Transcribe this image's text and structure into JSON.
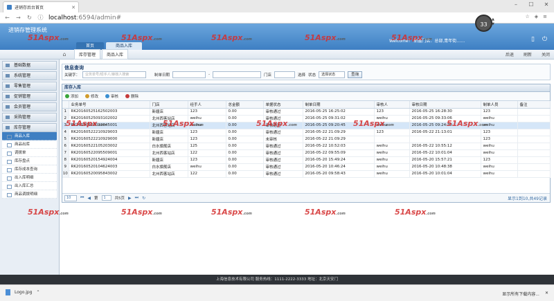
{
  "browser": {
    "tab_title": "进销存后台首页",
    "url_host": "localhost",
    "url_path": ":6594/admin#",
    "speed": "33"
  },
  "header": {
    "app_title": "进销存管理系统",
    "tabs": [
      {
        "label": "首页",
        "active": false
      },
      {
        "label": "商品入库",
        "active": true
      }
    ],
    "user_text": "Welcome！ 新疆门店：总部,青年街……"
  },
  "crumbs": {
    "items": [
      "库存管理",
      "商品入库"
    ],
    "actions": [
      "后退",
      "刷新",
      "关闭"
    ]
  },
  "sidebar": {
    "groups": [
      "基础数据",
      "系统管理",
      "零售管理",
      "促销管理",
      "会员管理",
      "采购管理",
      "库存管理"
    ],
    "items": [
      "商品入库",
      "商品出库",
      "调拨单",
      "库存盘点",
      "库存成本查询",
      "出入库明细",
      "出入库汇总",
      "商品调拨明细"
    ],
    "active_item": 0
  },
  "search": {
    "title": "信息查询",
    "keyword_label": "关键字：",
    "keyword_placeholder": "业务单号/经手人/审核人搜索",
    "date_label": "制单日期",
    "date_sep": "-",
    "store_label": "门店",
    "status_prefix": "选择",
    "status_label": "状态",
    "status_value": "选择状态",
    "query_button": "查询"
  },
  "grid": {
    "title": "库存入库",
    "toolbar": [
      "添加",
      "修改",
      "审核",
      "删除"
    ],
    "columns": [
      "业务单号",
      "门店",
      "经手人",
      "总金额",
      "单据状态",
      "制单日期",
      "审核人",
      "审核日期",
      "制单人员",
      "备注"
    ],
    "rows": [
      [
        "1",
        "RK20160525162502003",
        "新疆店",
        "123",
        "0.00",
        "审核通过",
        "2016-05-25 16:25:02",
        "123",
        "2016-05-25 16:28:30",
        "123",
        ""
      ],
      [
        "2",
        "RK20160525093102002",
        "北州西客站店",
        "weihu",
        "0.00",
        "审核通过",
        "2016-05-25 09:31:02",
        "weihu",
        "2016-05-25 09:33:06",
        "weihu",
        ""
      ],
      [
        "3",
        "RK20160525092045001",
        "北州西客站店",
        "weihu",
        "0.00",
        "审核通过",
        "2016-05-25 09:20:45",
        "weihu",
        "2016-05-25 09:24:30",
        "weihu",
        ""
      ],
      [
        "4",
        "RK20160522210929003",
        "新疆店",
        "123",
        "0.00",
        "审核通过",
        "2016-05-22 21:09:29",
        "123",
        "2016-05-22 21:13:01",
        "123",
        ""
      ],
      [
        "5",
        "RK20160522210929000",
        "新疆店",
        "123",
        "0.00",
        "未审核",
        "2016-05-22 21:09:29",
        "",
        "",
        "123",
        ""
      ],
      [
        "6",
        "RK20160522105203002",
        "白水旗舰店",
        "125",
        "0.00",
        "审核通过",
        "2016-05-22 10:52:03",
        "weihu",
        "2016-05-22 10:55:12",
        "weihu",
        ""
      ],
      [
        "7",
        "RK20160522095509001",
        "北州西客站店",
        "122",
        "0.00",
        "审核通过",
        "2016-05-22 09:55:09",
        "weihu",
        "2016-05-22 10:01:04",
        "weihu",
        ""
      ],
      [
        "8",
        "RK20160520154924004",
        "新疆店",
        "123",
        "0.00",
        "审核通过",
        "2016-05-20 15:49:24",
        "weihu",
        "2016-05-20 15:57:21",
        "123",
        ""
      ],
      [
        "9",
        "RK20160520104624003",
        "白水旗舰店",
        "weihu",
        "0.00",
        "审核通过",
        "2016-05-20 10:46:24",
        "weihu",
        "2016-05-20 10:48:38",
        "weihu",
        ""
      ],
      [
        "10",
        "RK20160520095843002",
        "北州西客站店",
        "122",
        "0.00",
        "审核通过",
        "2016-05-20 09:58:43",
        "weihu",
        "2016-05-20 10:01:04",
        "weihu",
        ""
      ]
    ],
    "selected_row": 2
  },
  "pager": {
    "page_size": "10",
    "page_prefix": "第",
    "page_value": "1",
    "page_suffix": "共5页",
    "info": "显示1到10,共49记录"
  },
  "footer": {
    "text": "上海信息技术有限公司  服务热线：1111-2222-3333 地址：北京天安门"
  },
  "downloads": {
    "file": "Logo.jpg",
    "show_all": "显示所有下载内容...",
    "close": "✕"
  },
  "watermark": {
    "brand": "51Aspx",
    "suffix": ".com"
  },
  "colors": {
    "header_blue": "#3e7fc3",
    "selected_row": "#d5e6f8",
    "watermark_red": "#d42f2f"
  }
}
